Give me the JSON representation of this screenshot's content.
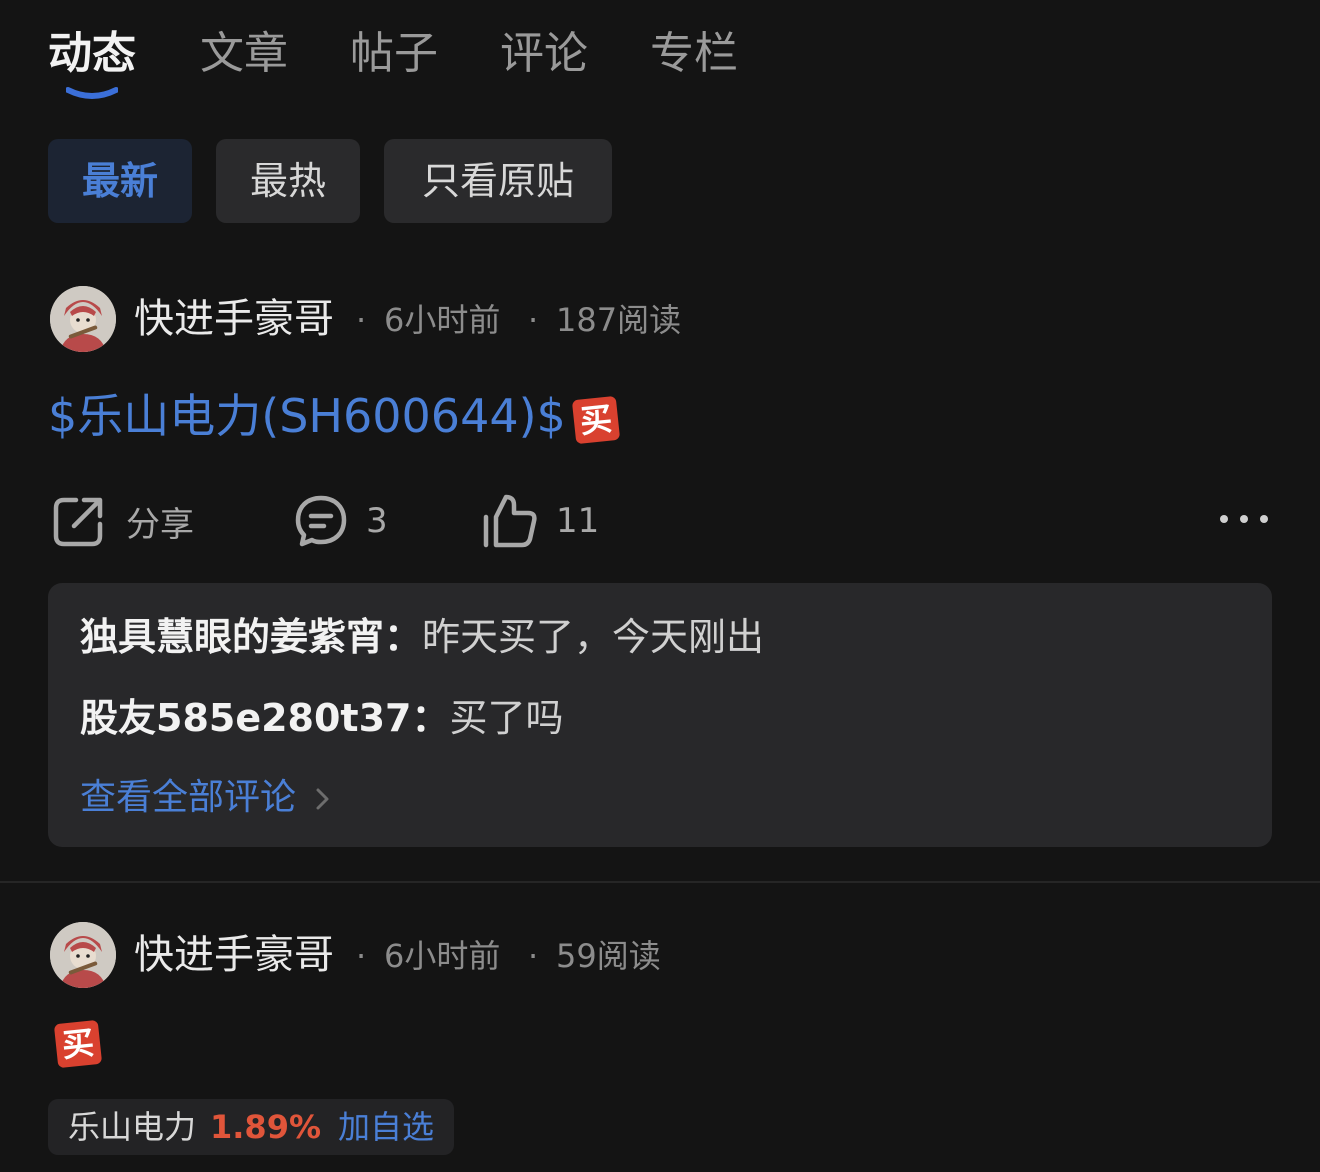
{
  "tabs": [
    {
      "label": "动态",
      "active": true
    },
    {
      "label": "文章",
      "active": false
    },
    {
      "label": "帖子",
      "active": false
    },
    {
      "label": "评论",
      "active": false
    },
    {
      "label": "专栏",
      "active": false
    }
  ],
  "filters": [
    {
      "label": "最新",
      "active": true
    },
    {
      "label": "最热",
      "active": false
    },
    {
      "label": "只看原贴",
      "active": false
    }
  ],
  "posts": [
    {
      "author": "快进手豪哥",
      "time": "6小时前",
      "reads": "187阅读",
      "stock_link": "$乐山电力(SH600644)$",
      "emoji": "买",
      "actions": {
        "share_label": "分享",
        "comment_count": "3",
        "like_count": "11"
      },
      "comments": [
        {
          "name": "独具慧眼的姜紫宵：",
          "text": "昨天买了，今天刚出"
        },
        {
          "name": "股友585e280t37：",
          "text": "买了吗"
        }
      ],
      "view_all": "查看全部评论"
    },
    {
      "author": "快进手豪哥",
      "time": "6小时前",
      "reads": "59阅读",
      "emoji": "买",
      "stock_chip": {
        "name": "乐山电力",
        "change": "1.89%",
        "add_label": "加自选"
      }
    }
  ],
  "meta_separator": "·",
  "colors": {
    "background": "#141414",
    "accent_blue": "#4a7fd6",
    "rise_red": "#e0553a",
    "badge_red": "#d9412f"
  }
}
